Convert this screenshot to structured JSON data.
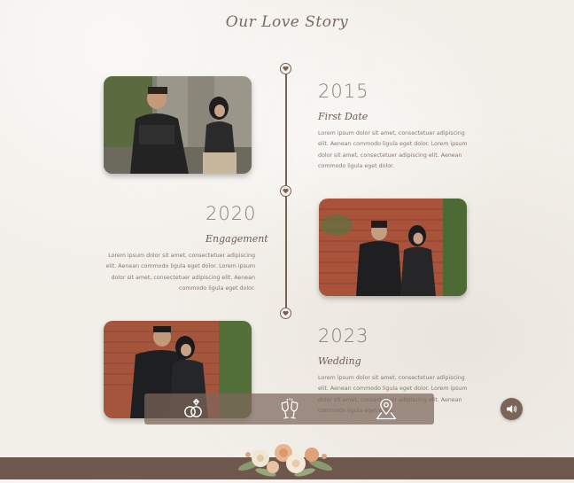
{
  "page": {
    "title": "Our Love Story"
  },
  "timeline": [
    {
      "year": "2015",
      "event": "First Date",
      "description": "Lorem ipsum dolor sit amet, consectetuer adipiscing elit. Aenean commodo ligula eget dolor. Lorem ipsum dolor sit amet, consectetuer adipiscing elit. Aenean commodo ligula eget dolor."
    },
    {
      "year": "2020",
      "event": "Engagement",
      "description": "Lorem ipsum dolor sit amet, consectetuer adipiscing elit. Aenean commodo ligula eget dolor. Lorem ipsum dolor sit amet, consectetuer adipiscing elit. Aenean commodo ligula eget dolor."
    },
    {
      "year": "2023",
      "event": "Wedding",
      "description": "Lorem ipsum dolor sit amet, consectetuer adipiscing elit. Aenean commodo ligula eget dolor. Lorem ipsum dolor sit amet, consectetuer adipiscing elit. Aenean commodo ligula eget dolor."
    }
  ],
  "nav": {
    "items": [
      {
        "icon": "rings-icon"
      },
      {
        "icon": "champagne-toast-icon"
      },
      {
        "icon": "map-pin-icon"
      }
    ]
  },
  "audio": {
    "icon": "speaker-icon"
  },
  "colors": {
    "accent": "#7b5f55",
    "background": "#f2efe9",
    "footer": "#6e574d"
  }
}
